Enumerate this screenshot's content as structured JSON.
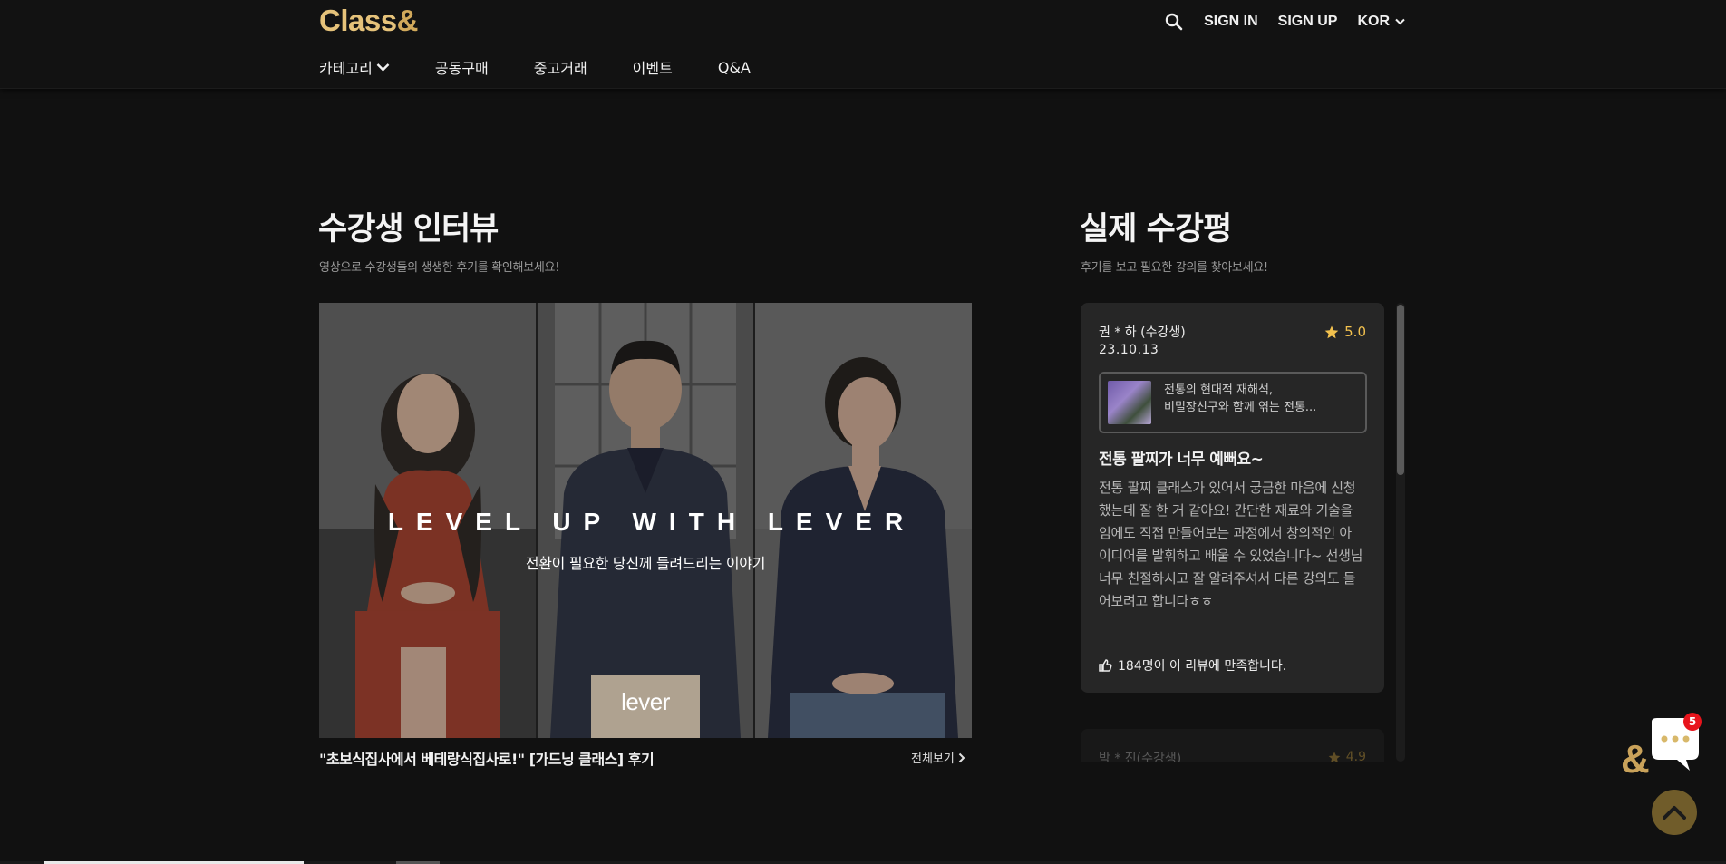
{
  "header": {
    "logo": {
      "main": "Class",
      "amp": "&"
    },
    "search_icon": "search-icon",
    "sign_in": "SIGN IN",
    "sign_up": "SIGN UP",
    "language": "KOR",
    "nav": [
      {
        "label": "카테고리",
        "has_dropdown": true
      },
      {
        "label": "공동구매"
      },
      {
        "label": "중고거래"
      },
      {
        "label": "이벤트"
      },
      {
        "label": "Q&A"
      }
    ]
  },
  "interview": {
    "title": "수강생 인터뷰",
    "subtitle": "영상으로 수강생들의 생생한 후기를 확인해보세요!",
    "video": {
      "headline": "LEVEL UP WITH LEVER",
      "subline": "전환이 필요한 당신께 들려드리는 이야기",
      "brand": "lever"
    },
    "caption": "\"초보식집사에서 베테랑식집사로!\" [가드닝 클래스] 후기",
    "view_all": "전체보기"
  },
  "reviews": {
    "title": "실제 수강평",
    "subtitle": "후기를 보고 필요한 강의를 찾아보세요!",
    "items": [
      {
        "reviewer": "권 * 하 (수강생)",
        "date": "23.10.13",
        "rating": "5.0",
        "class_line1": "전통의 현대적 재해석,",
        "class_line2": "비밀장신구와 함께 엮는 전통...",
        "title": "전통 팔찌가 너무 예뻐요~",
        "body": "전통 팔찌 클래스가 있어서 궁금한 마음에 신청했는데 잘 한 거 같아요! 간단한 재료와 기술을 임에도 직접 만들어보는 과정에서 창의적인 아이디어를 발휘하고 배울 수 있었습니다~ 선생님 너무 친절하시고 잘 알려주셔서 다른 강의도 들어보려고 합니다ㅎㅎ",
        "likes": "184명이 이 리뷰에 만족합니다."
      },
      {
        "reviewer": "박 * 진(수강생)",
        "rating": "4.9"
      }
    ]
  },
  "floating": {
    "chat_badge": "5",
    "chat_icon": "chat-icon",
    "top_icon": "chevron-up-icon"
  }
}
